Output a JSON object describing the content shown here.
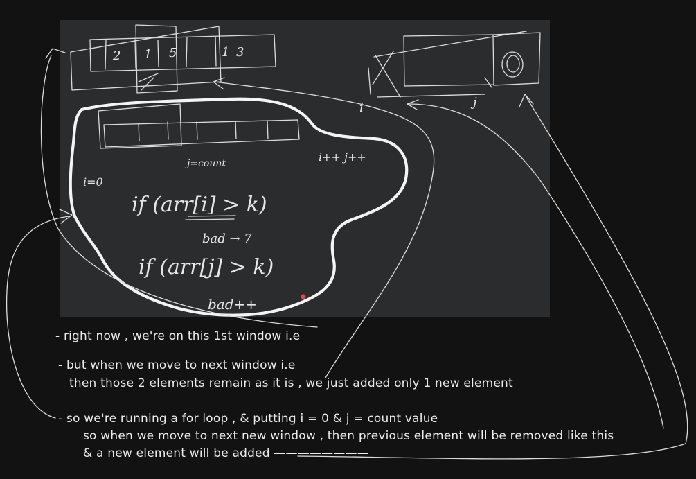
{
  "sketch": {
    "window1_cells": [
      "2",
      "1",
      "5",
      "1",
      "3"
    ],
    "index_i": "i",
    "index_j": "j",
    "init_i": "i=0",
    "init_j": "j=count",
    "increments": "i++   j++",
    "cond_i": "if (arr[i] > k)",
    "bad_i": "bad → 7",
    "cond_j": "if (arr[j] > k)",
    "bad_j": "bad++"
  },
  "notes": {
    "line1": "- right now , we're on this 1st window i.e",
    "line2a": "- but when we move to next window i.e",
    "line2b": "then those 2 elements remain as it is , we just added only 1 new element",
    "line3a": "- so we're running a for loop , & putting i = 0 & j = count value",
    "line3b": "so when we move to next new window , then previous element will be removed like this",
    "line3c": "& a new element will be added ————————"
  },
  "colors": {
    "background": "#121212",
    "board": "#2b2c2e",
    "ink": "#dcdcdc",
    "laser_dot": "#e0474c"
  }
}
